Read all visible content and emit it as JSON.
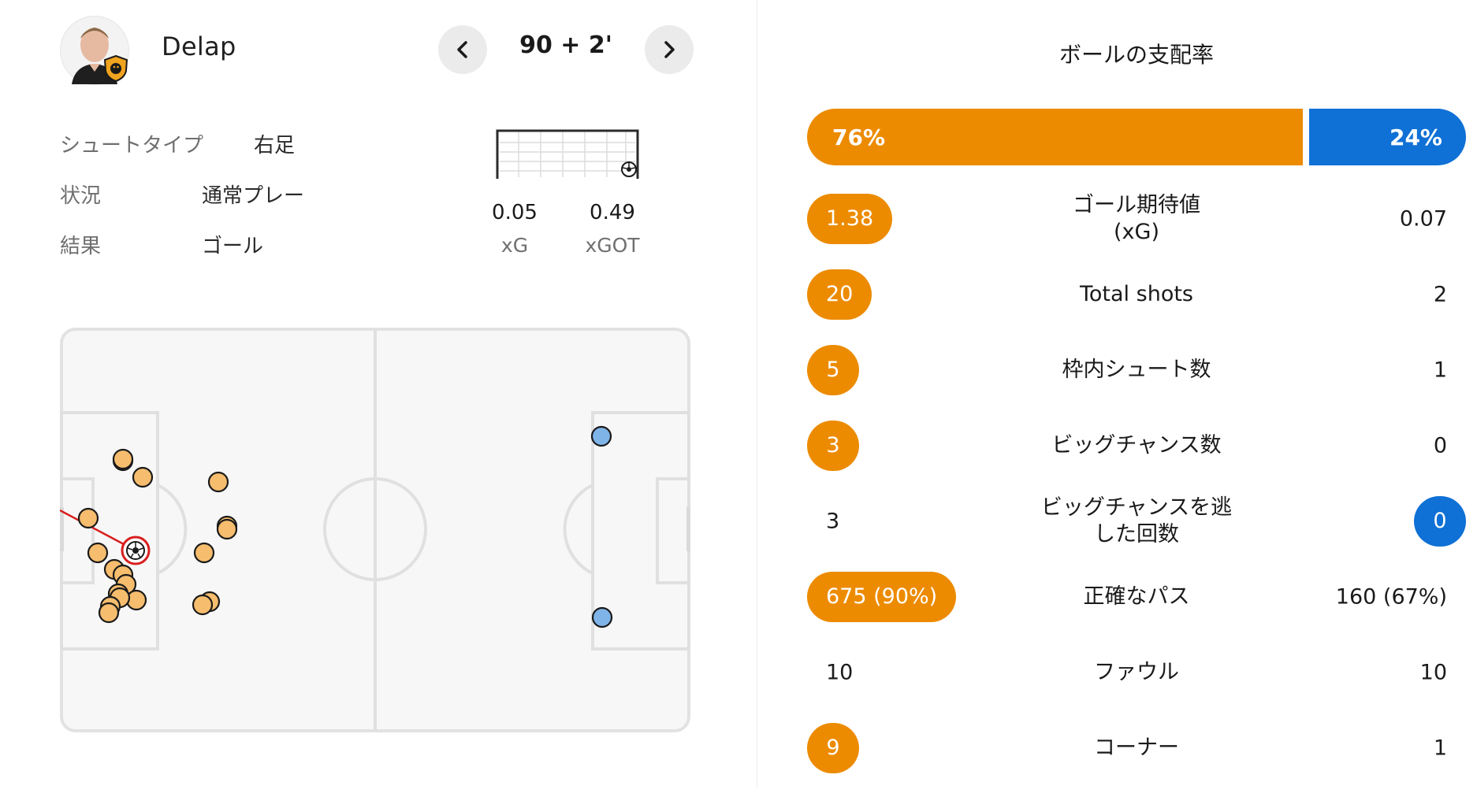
{
  "shot": {
    "player_name": "Delap",
    "minute": "90 + 2'",
    "prev_icon": "chevron-left-icon",
    "next_icon": "chevron-right-icon",
    "shot_type_label": "シュートタイプ",
    "shot_type_value": "右足",
    "situation_label": "状況",
    "situation_value": "通常プレー",
    "result_label": "結果",
    "result_value": "ゴール",
    "xg_value": "0.05",
    "xg_label": "xG",
    "xgot_value": "0.49",
    "xgot_label": "xGOT"
  },
  "colors": {
    "home": "#ec8b00",
    "away": "#0f70d6",
    "home_shot_fill": "#f6bd6e",
    "away_shot_fill": "#7fb4e8",
    "selected_ring": "#d81e1e"
  },
  "shot_map": {
    "selected_shot": "ball-icon"
  },
  "stats": {
    "possession_title": "ボールの支配率",
    "possession_home": "76%",
    "possession_away": "24%",
    "possession_home_value": 76,
    "possession_away_value": 24,
    "rows": [
      {
        "label": "ゴール期待値\n(xG)",
        "home": "1.38",
        "away": "0.07",
        "highlight": "home"
      },
      {
        "label": "Total shots",
        "home": "20",
        "away": "2",
        "highlight": "home"
      },
      {
        "label": "枠内シュート数",
        "home": "5",
        "away": "1",
        "highlight": "home"
      },
      {
        "label": "ビッグチャンス数",
        "home": "3",
        "away": "0",
        "highlight": "home"
      },
      {
        "label": "ビッグチャンスを逃\nした回数",
        "home": "3",
        "away": "0",
        "highlight": "away"
      },
      {
        "label": "正確なパス",
        "home": "675 (90%)",
        "away": "160 (67%)",
        "highlight": "home"
      },
      {
        "label": "ファウル",
        "home": "10",
        "away": "10",
        "highlight": "none"
      },
      {
        "label": "コーナー",
        "home": "9",
        "away": "1",
        "highlight": "home"
      }
    ]
  }
}
